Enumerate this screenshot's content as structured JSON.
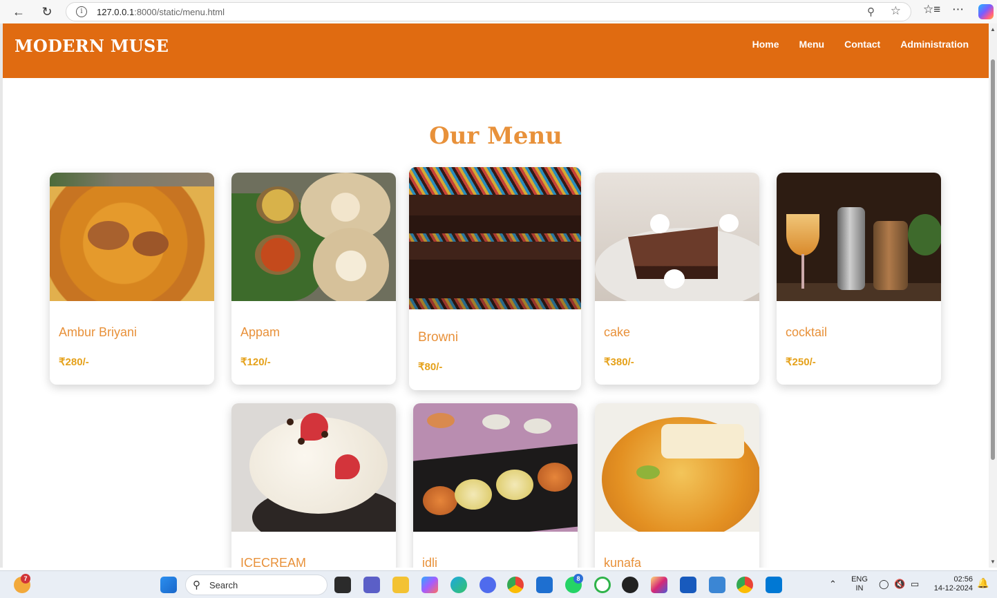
{
  "browser": {
    "url_host": "127.0.0.1",
    "url_rest": ":8000/static/menu.html"
  },
  "site": {
    "brand": "MODERN MUSE",
    "nav": [
      "Home",
      "Menu",
      "Contact",
      "Administration"
    ],
    "title": "Our Menu"
  },
  "menu": [
    {
      "name": "Ambur Briyani",
      "price": "₹280/-"
    },
    {
      "name": "Appam",
      "price": "₹120/-"
    },
    {
      "name": "Browni",
      "price": "₹80/-"
    },
    {
      "name": "cake",
      "price": "₹380/-"
    },
    {
      "name": "cocktail",
      "price": "₹250/-"
    },
    {
      "name": "ICECREAM",
      "price": ""
    },
    {
      "name": "idli",
      "price": ""
    },
    {
      "name": "kunafa",
      "price": ""
    }
  ],
  "taskbar": {
    "search_label": "Search",
    "weather_badge": "7",
    "whatsapp_badge": "8",
    "lang_top": "ENG",
    "lang_bottom": "IN",
    "time": "02:56",
    "date": "14-12-2024"
  },
  "colors": {
    "header": "#e06b11",
    "title": "#e8913a",
    "price": "#e5a11a"
  }
}
